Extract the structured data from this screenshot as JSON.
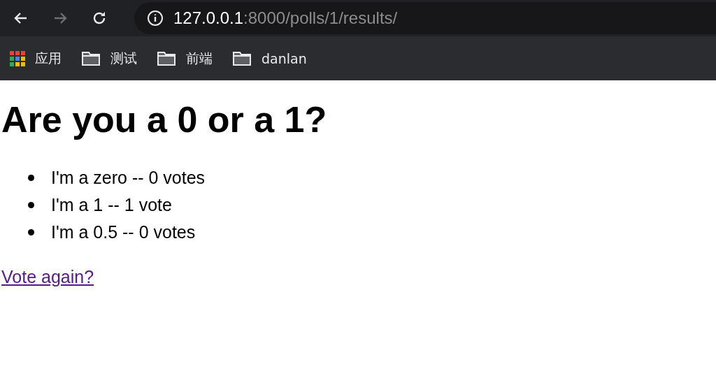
{
  "toolbar": {
    "nav_buttons": [
      {
        "kind": "back",
        "disabled": false
      },
      {
        "kind": "forward",
        "disabled": true
      },
      {
        "kind": "reload",
        "disabled": false
      }
    ],
    "address": {
      "host": "127.0.0.1",
      "path": ":8000/polls/1/results/"
    }
  },
  "bookmarks": [
    {
      "kind": "apps",
      "label": "应用"
    },
    {
      "kind": "folder",
      "label": "测试"
    },
    {
      "kind": "folder",
      "label": "前端"
    },
    {
      "kind": "folder",
      "label": "danlan"
    }
  ],
  "page": {
    "heading": "Are you a 0 or a 1?",
    "results": [
      "I'm a zero -- 0 votes",
      "I'm a 1 -- 1 vote",
      "I'm a 0.5 -- 0 votes"
    ],
    "link": {
      "label": "Vote again?",
      "visited": true
    }
  }
}
